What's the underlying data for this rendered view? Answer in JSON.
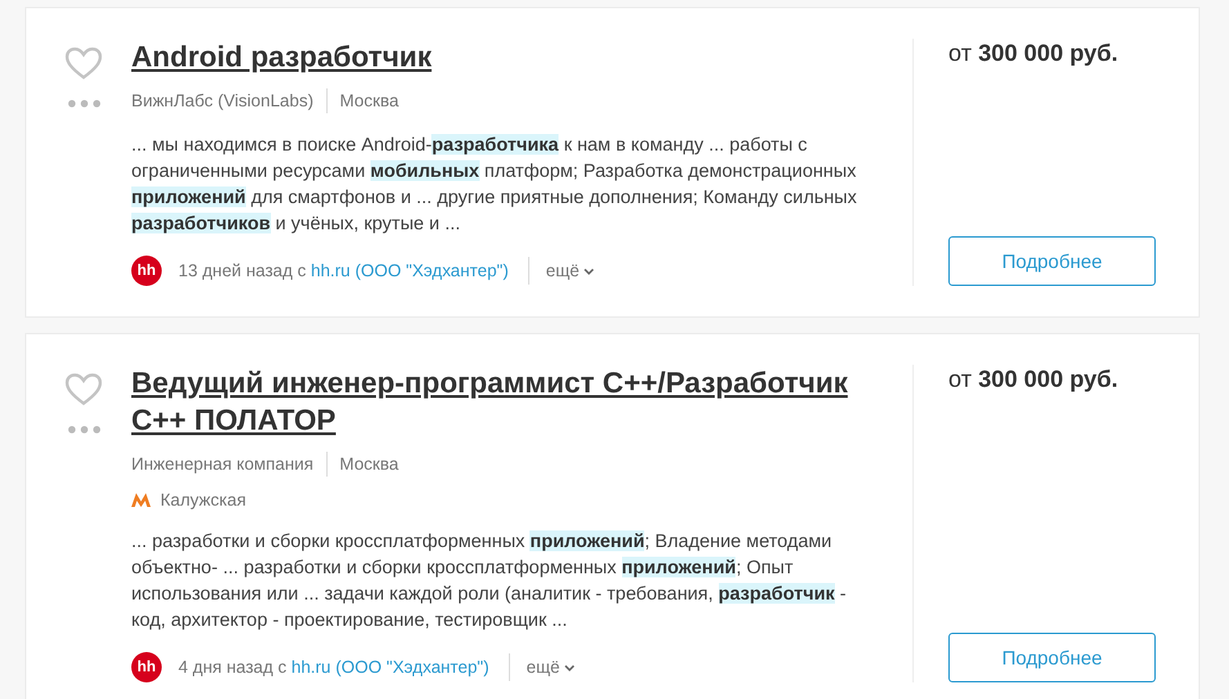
{
  "vacancies": [
    {
      "title": "Android разработчик",
      "favorite": false,
      "company": "ВижнЛабс (VisionLabs)",
      "city": "Москва",
      "snippet": "... мы находимся в поиске Android-**разработчика** к нам в команду ... работы с ограниченными ресурсами **мобильных** платформ; Разработка демонстрационных **приложений** для смартфонов и ... другие приятные дополнения; Команду сильных **разработчиков** и учёных, крутые и ...",
      "source_logo": "hh",
      "posted": "13 дней назад с",
      "source": "hh.ru (ООО \"Хэдхантер\")",
      "more": "ещё",
      "price": "от **300 000 руб.**",
      "button": "Подробнее"
    },
    {
      "title": "Ведущий инженер-программист С++/Разработчик С++ ПОЛАТОР",
      "favorite": false,
      "company": "Инженерная компания",
      "city": "Москва",
      "metro": "Калужская",
      "snippet": "... разработки и сборки кроссплатформенных **приложений**; Владение методами объектно- ... разработки и сборки кроссплатформенных **приложений**; Опыт использования или ... задачи каждой роли (аналитик - требования, **разработчик** - код, архитектор - проектирование, тестировщик ...",
      "source_logo": "hh",
      "posted": "4 дня назад с",
      "source": "hh.ru (ООО \"Хэдхантер\")",
      "more": "ещё",
      "price": "от **300 000 руб.**",
      "button": "Подробнее"
    }
  ]
}
